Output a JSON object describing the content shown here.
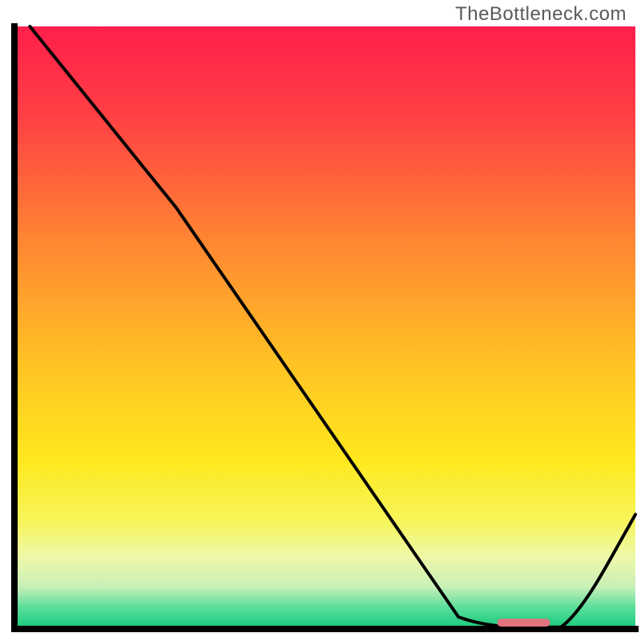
{
  "watermark": "TheBottleneck.com",
  "chart_data": {
    "type": "line",
    "title": "",
    "xlabel": "",
    "ylabel": "",
    "xlim": [
      0,
      100
    ],
    "ylim": [
      0,
      100
    ],
    "grid": false,
    "legend": false,
    "marker": {
      "x": 82,
      "y": 0,
      "width": 8.5,
      "height": 1.3,
      "color": "#e2737e"
    },
    "curve_points": [
      {
        "x": 2.5,
        "y": 100
      },
      {
        "x": 20.5,
        "y": 77
      },
      {
        "x": 26.0,
        "y": 70
      },
      {
        "x": 71.5,
        "y": 2
      },
      {
        "x": 76.0,
        "y": 0.3
      },
      {
        "x": 88.0,
        "y": 0.3
      },
      {
        "x": 91.0,
        "y": 2.5
      },
      {
        "x": 100,
        "y": 19
      }
    ],
    "background_gradient_stops": [
      {
        "offset": 0.0,
        "color": "#ff1f4b"
      },
      {
        "offset": 0.15,
        "color": "#ff4044"
      },
      {
        "offset": 0.35,
        "color": "#ff8433"
      },
      {
        "offset": 0.55,
        "color": "#ffc025"
      },
      {
        "offset": 0.72,
        "color": "#ffe81e"
      },
      {
        "offset": 0.82,
        "color": "#f7f55a"
      },
      {
        "offset": 0.88,
        "color": "#eef8a8"
      },
      {
        "offset": 0.93,
        "color": "#c8f0b8"
      },
      {
        "offset": 0.965,
        "color": "#59dd9a"
      },
      {
        "offset": 1.0,
        "color": "#15c97c"
      }
    ],
    "axis_color": "#000000",
    "axis_width": 8,
    "line_color": "#000000",
    "line_width": 4
  }
}
